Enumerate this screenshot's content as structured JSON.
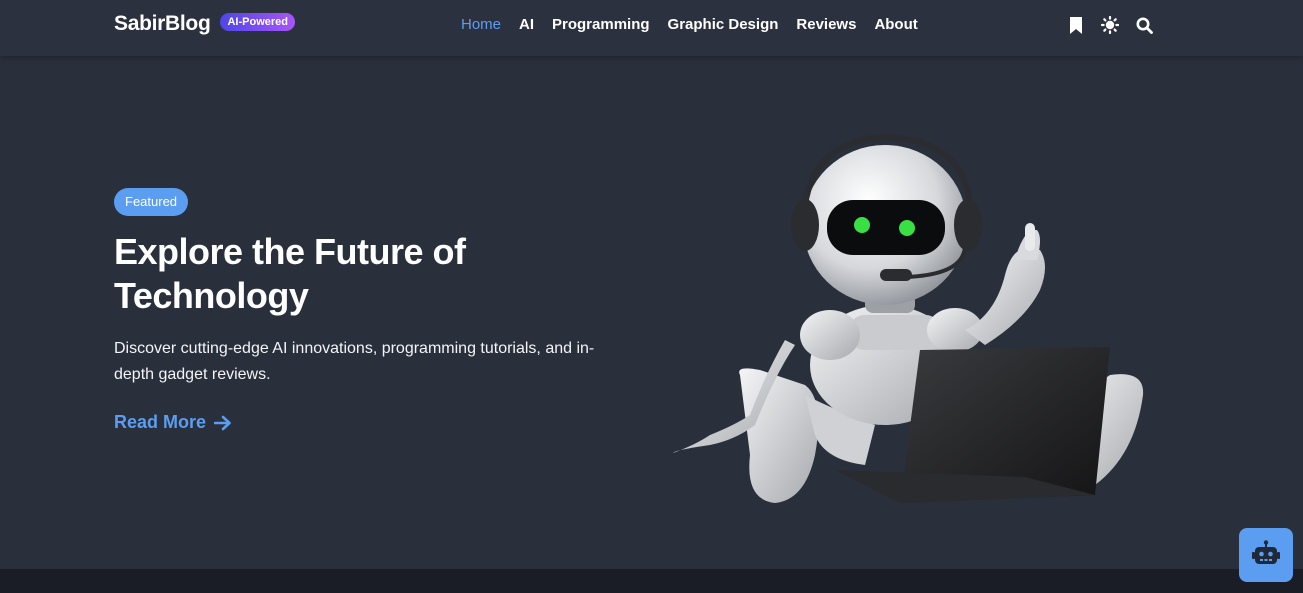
{
  "header": {
    "brand_name": "SabirBlog",
    "brand_badge": "AI-Powered",
    "nav": [
      {
        "label": "Home",
        "active": true
      },
      {
        "label": "AI",
        "active": false
      },
      {
        "label": "Programming",
        "active": false
      },
      {
        "label": "Graphic Design",
        "active": false
      },
      {
        "label": "Reviews",
        "active": false
      },
      {
        "label": "About",
        "active": false
      }
    ],
    "icons": [
      "bookmark-icon",
      "theme-toggle-sun-icon",
      "search-icon"
    ]
  },
  "hero": {
    "badge": "Featured",
    "title": "Explore the Future of Technology",
    "description": "Discover cutting-edge AI innovations, programming tutorials, and in-depth gadget reviews.",
    "cta_label": "Read More",
    "image_subject": "robot-with-headset-and-laptop"
  },
  "chat_widget": {
    "icon": "robot-chat-icon"
  },
  "colors": {
    "accent": "#5b9df0",
    "background": "#2a2f3c",
    "navbar": "#2c3140",
    "footer": "#1a1d25",
    "badge_gradient_start": "#4f46e5",
    "badge_gradient_end": "#a855f7"
  }
}
